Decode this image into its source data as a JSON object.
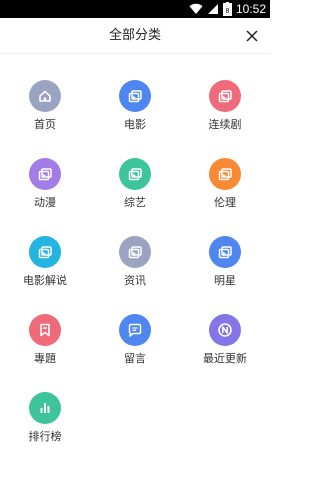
{
  "status": {
    "time": "10:52",
    "battery": "8"
  },
  "header": {
    "title": "全部分类"
  },
  "categories": [
    {
      "label": "首页",
      "icon": "home-icon",
      "color": "#9ba3c2"
    },
    {
      "label": "电影",
      "icon": "video-icon",
      "color": "#4f86f0"
    },
    {
      "label": "连续剧",
      "icon": "video-icon",
      "color": "#ef6b7a"
    },
    {
      "label": "动漫",
      "icon": "video-icon",
      "color": "#a27de6"
    },
    {
      "label": "综艺",
      "icon": "video-icon",
      "color": "#3ec49a"
    },
    {
      "label": "伦理",
      "icon": "video-icon",
      "color": "#f98934"
    },
    {
      "label": "电影解说",
      "icon": "video-icon",
      "color": "#23b4e0"
    },
    {
      "label": "资讯",
      "icon": "video-icon",
      "color": "#9ba3c2"
    },
    {
      "label": "明星",
      "icon": "video-icon",
      "color": "#4f86f0"
    },
    {
      "label": "專題",
      "icon": "bookmark-icon",
      "color": "#ef6b7a"
    },
    {
      "label": "留言",
      "icon": "message-icon",
      "color": "#4f86f0"
    },
    {
      "label": "最近更新",
      "icon": "new-icon",
      "color": "#8576e8"
    },
    {
      "label": "排行榜",
      "icon": "bar-chart-icon",
      "color": "#3ec49a"
    }
  ]
}
